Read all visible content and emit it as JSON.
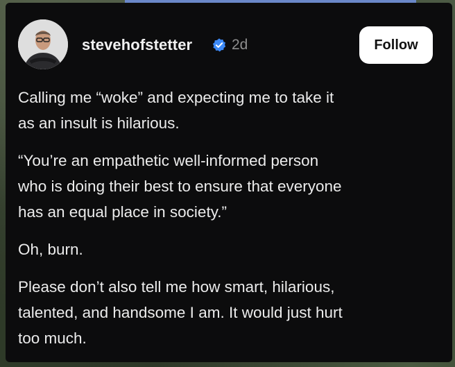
{
  "post": {
    "username": "stevehofstetter",
    "time": "2d",
    "follow_label": "Follow",
    "verified_color": "#3d8af7",
    "lines": [
      {
        "l1": "Calling me “woke” and expecting me to take it",
        "l2": "as an insult is hilarious."
      },
      {
        "l1": "“You’re an empathetic well-informed person",
        "l2": "who is doing their best to ensure that everyone",
        "l3": "has an equal place in society.”"
      },
      {
        "l1": "Oh, burn."
      },
      {
        "l1": "Please don’t also tell me how smart, hilarious,",
        "l2": "talented, and handsome I am. It would just hurt",
        "l3": "too much."
      }
    ]
  }
}
